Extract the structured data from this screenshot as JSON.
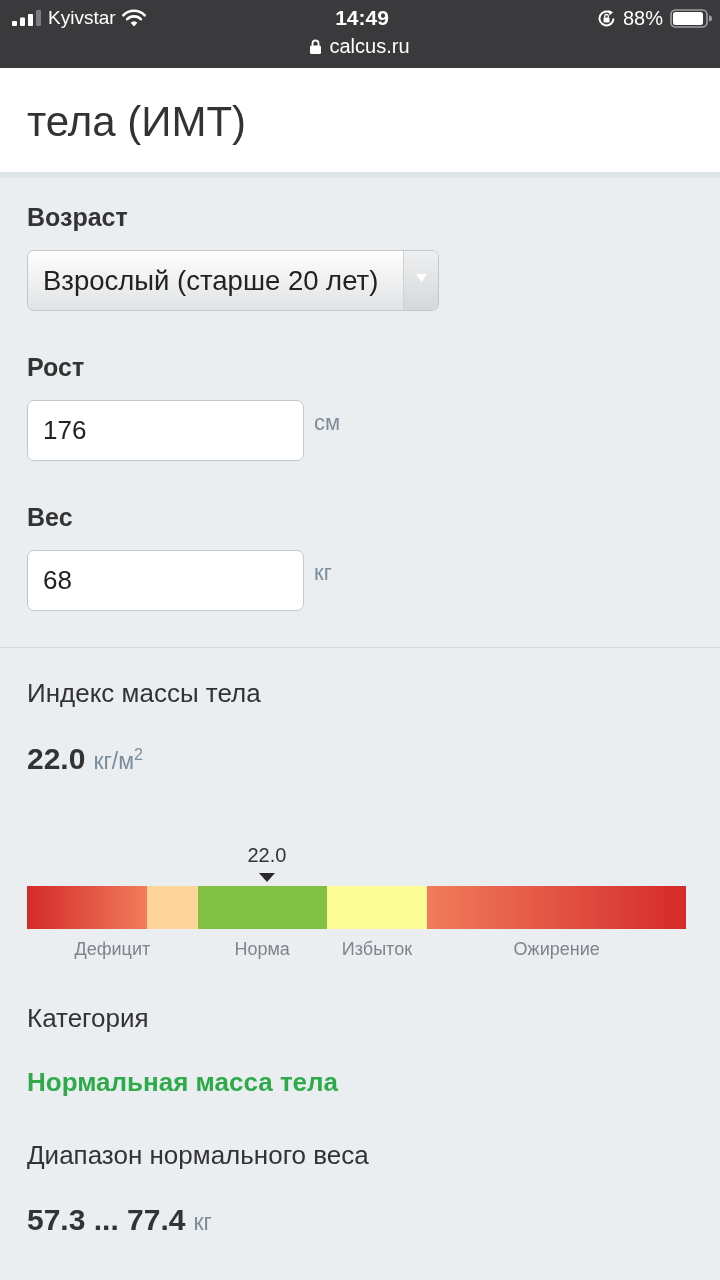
{
  "status_bar": {
    "carrier": "Kyivstar",
    "time": "14:49",
    "battery": "88%",
    "url": "calcus.ru"
  },
  "header": {
    "title": "тела (ИМТ)"
  },
  "form": {
    "fields": [
      {
        "kind": "select",
        "label": "Возраст",
        "value": "Взрослый (старше 20 лет)"
      },
      {
        "kind": "number",
        "label": "Рост",
        "value": "176",
        "unit": "см"
      },
      {
        "kind": "number",
        "label": "Вес",
        "value": "68",
        "unit": "кг"
      }
    ]
  },
  "result": {
    "bmi_label": "Индекс массы тела",
    "bmi_value": "22.0",
    "bmi_unit": "кг/м$^{2}$",
    "scale": {
      "marker": {
        "label": "22.0",
        "level": 0.364
      },
      "zones": [
        {
          "label": "Дефицит",
          "bands": [
            {
              "kind": "fade-right",
              "color": "#d42a2a"
            },
            {
              "kind": "solid",
              "color": "#fdd49a"
            }
          ]
        },
        {
          "label": "Норма",
          "bands": [
            {
              "kind": "solid",
              "color": "#82bf45"
            }
          ]
        },
        {
          "label": "Избыток",
          "bands": [
            {
              "kind": "solid",
              "color": "#fdfd96"
            }
          ]
        },
        {
          "label": "Ожирение",
          "bands": [
            {
              "kind": "fade-left",
              "color": "#d42a2a"
            }
          ]
        }
      ]
    },
    "category": {
      "label": "Категория",
      "value": "Нормальная масса тела",
      "kind": "normal"
    },
    "range": {
      "label": "Диапазон нормального веса",
      "value": "57.3 ... 77.4",
      "unit": "кг"
    }
  }
}
